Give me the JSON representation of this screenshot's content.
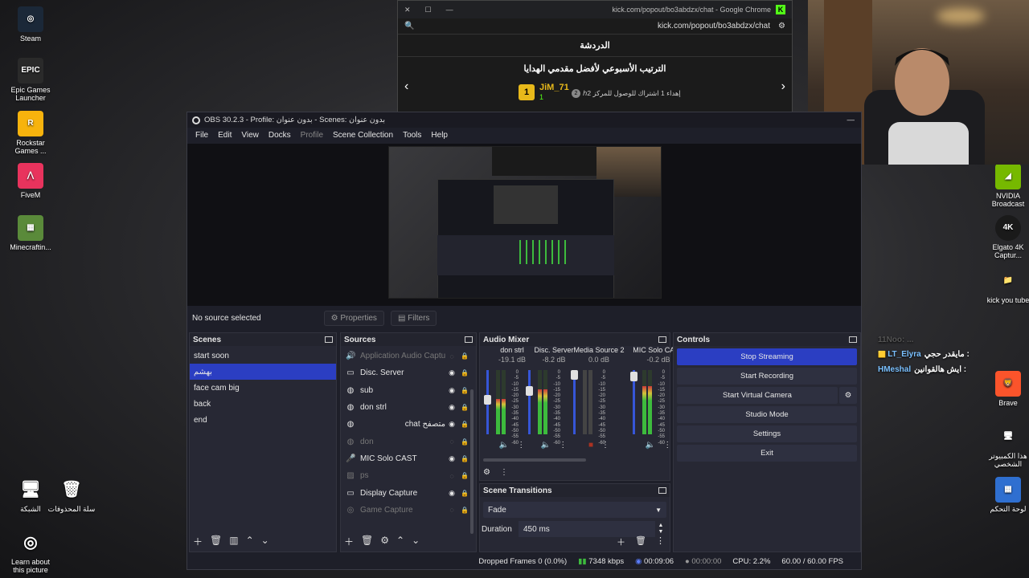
{
  "desktop_left": [
    {
      "label": "Steam",
      "icon": "steam-icon",
      "color": "#1b2838"
    },
    {
      "label": "Epic Games Launcher",
      "icon": "epic-games-icon",
      "color": "#2a2a2a"
    },
    {
      "label": "Rockstar Games ...",
      "icon": "rockstar-icon",
      "color": "#f7b30d"
    },
    {
      "label": "FiveM",
      "icon": "fivem-icon",
      "color": "#e8335d"
    },
    {
      "label": "Minecraftin...",
      "icon": "minecraft-icon",
      "color": "#5a8a3a"
    }
  ],
  "desktop_bottom_left": [
    {
      "label": "الشبكة",
      "icon": "network-icon"
    },
    {
      "label": "سلة المحذوفات",
      "icon": "recycle-bin-icon"
    },
    {
      "label": "Learn about this picture",
      "icon": "learn-about-icon"
    }
  ],
  "desktop_right": [
    {
      "label": "NVIDIA Broadcast",
      "icon": "nvidia-broadcast-icon"
    },
    {
      "label": "Elgato 4K Captur...",
      "icon": "elgato-4k-icon"
    },
    {
      "label": "kick you tube",
      "icon": "folder-icon"
    },
    {
      "label": "Brave",
      "icon": "brave-icon"
    },
    {
      "label": "هذا الكمبيوتر الشخصي",
      "icon": "this-pc-icon"
    },
    {
      "label": "لوحة التحكم",
      "icon": "control-panel-icon"
    }
  ],
  "chrome": {
    "title": "kick.com/popout/bo3abdzx/chat - Google Chrome",
    "url": "kick.com/popout/bo3abdzx/chat",
    "chat_header": "الدردشة",
    "board_title": "الترتيب الأسبوعي لأفضل مقدمي الهدايا",
    "leader_name": "JiM_71",
    "leader_rank": "1",
    "leader_count": "1",
    "leader_text": "ℎإهداء 1 اشتراك للوصول للمركز 2",
    "leader_place": "2"
  },
  "obs": {
    "title": "OBS 30.2.3 - Profile: بدون عنوان - Scenes: بدون عنوان",
    "menu": [
      "File",
      "Edit",
      "View",
      "Docks",
      "Profile",
      "Scene Collection",
      "Tools",
      "Help"
    ],
    "no_source": "No source selected",
    "properties": "Properties",
    "filters": "Filters",
    "scenes_title": "Scenes",
    "scenes": [
      "start soon",
      "بهشم",
      "face cam big",
      "back",
      "end"
    ],
    "selected_scene": 1,
    "sources_title": "Sources",
    "sources": [
      {
        "name": "Application Audio Capture",
        "icon": "speaker-icon",
        "dim": true
      },
      {
        "name": "Disc. Server",
        "icon": "window-icon",
        "dim": false
      },
      {
        "name": "sub",
        "icon": "globe-icon",
        "dim": false
      },
      {
        "name": "don strl",
        "icon": "globe-icon",
        "dim": false
      },
      {
        "name": "chat متصفح",
        "icon": "globe-icon",
        "dim": false
      },
      {
        "name": "don",
        "icon": "globe-icon",
        "dim": true
      },
      {
        "name": "MIC Solo CAST",
        "icon": "mic-icon",
        "dim": false
      },
      {
        "name": "ps",
        "icon": "image-icon",
        "dim": true
      },
      {
        "name": "Display Capture",
        "icon": "monitor-icon",
        "dim": false
      },
      {
        "name": "Game Capture",
        "icon": "gamepad-icon",
        "dim": true
      }
    ],
    "mixer_title": "Audio Mixer",
    "mixer": [
      {
        "name": "don strl",
        "db": "-19.1 dB",
        "level": 0.55,
        "fader": 0.55,
        "muted": false
      },
      {
        "name": "Disc. Server",
        "db": "-8.2 dB",
        "level": 0.7,
        "fader": 0.7,
        "muted": false
      },
      {
        "name": "Media Source 2",
        "db": "0.0 dB",
        "level": 0.0,
        "fader": 1.0,
        "muted": true
      },
      {
        "name": "MIC Solo CAST",
        "db": "-0.2 dB",
        "level": 0.75,
        "fader": 0.97,
        "muted": false
      }
    ],
    "scale": [
      "0",
      "-5",
      "-10",
      "-15",
      "-20",
      "-25",
      "-30",
      "-35",
      "-40",
      "-45",
      "-50",
      "-55",
      "-60"
    ],
    "transitions_title": "Scene Transitions",
    "transition": "Fade",
    "duration_label": "Duration",
    "duration": "450 ms",
    "controls_title": "Controls",
    "controls": [
      "Stop Streaming",
      "Start Recording",
      "Start Virtual Camera",
      "Studio Mode",
      "Settings",
      "Exit"
    ],
    "status": {
      "dropped": "Dropped Frames 0 (0.0%)",
      "bitrate": "7348 kbps",
      "stream_time": "00:09:06",
      "rec_time": "00:00:00",
      "cpu": "CPU: 2.2%",
      "fps": "60.00 / 60.00 FPS"
    }
  },
  "chat_overlay": [
    {
      "user": "LT_Elyra",
      "msg": "مايقدر حجي :",
      "color": "#7ac0ff"
    },
    {
      "user": "HMeshal",
      "msg": "ايش هالقوانين :",
      "color": "#7ac0ff"
    }
  ],
  "chat_overlay_faded": "11Noo: ...",
  "colors": {
    "accent": "#2b3ec2",
    "kick_green": "#53fc18"
  }
}
